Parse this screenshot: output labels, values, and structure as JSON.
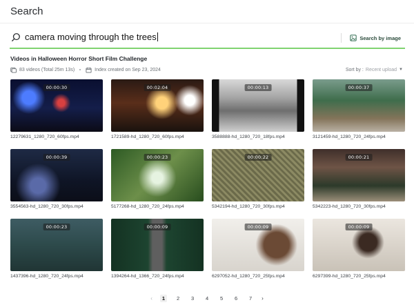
{
  "header": {
    "title": "Search"
  },
  "search": {
    "query": "camera moving through the trees",
    "by_image_label": "Search by image"
  },
  "index": {
    "title": "Videos in Halloween Horror Short Film Challenge",
    "video_count": "83 videos (Total 25m 13s)",
    "created": "Index created on Sep 23, 2024"
  },
  "sort": {
    "label": "Sort by :",
    "value": "Recent upload"
  },
  "results": [
    {
      "duration": "00:00:30",
      "filename": "12279631_1280_720_60fps.mp4"
    },
    {
      "duration": "00:02:04",
      "filename": "1721589-hd_1280_720_60fps.mp4"
    },
    {
      "duration": "00:00:13",
      "filename": "3588888-hd_1280_720_18fps.mp4"
    },
    {
      "duration": "00:00:37",
      "filename": "3121459-hd_1280_720_24fps.mp4"
    },
    {
      "duration": "00:00:39",
      "filename": "3554563-hd_1280_720_30fps.mp4"
    },
    {
      "duration": "00:00:23",
      "filename": "5177268-hd_1280_720_24fps.mp4"
    },
    {
      "duration": "00:00:22",
      "filename": "5342194-hd_1280_720_30fps.mp4"
    },
    {
      "duration": "00:00:21",
      "filename": "5342223-hd_1280_720_30fps.mp4"
    },
    {
      "duration": "00:00:23",
      "filename": "1437396-hd_1280_720_24fps.mp4"
    },
    {
      "duration": "00:00:09",
      "filename": "1394264-hd_1366_720_24fps.mp4"
    },
    {
      "duration": "00:00:09",
      "filename": "6297052-hd_1280_720_25fps.mp4"
    },
    {
      "duration": "00:00:09",
      "filename": "6297399-hd_1280_720_25fps.mp4"
    }
  ],
  "pagination": {
    "prev": "‹",
    "pages": [
      "1",
      "2",
      "3",
      "4",
      "5",
      "6",
      "7"
    ],
    "active": "1",
    "next": "›"
  },
  "colors": {
    "accent": "#7fd36f",
    "text": "#1f2328",
    "muted": "#6b7075"
  }
}
